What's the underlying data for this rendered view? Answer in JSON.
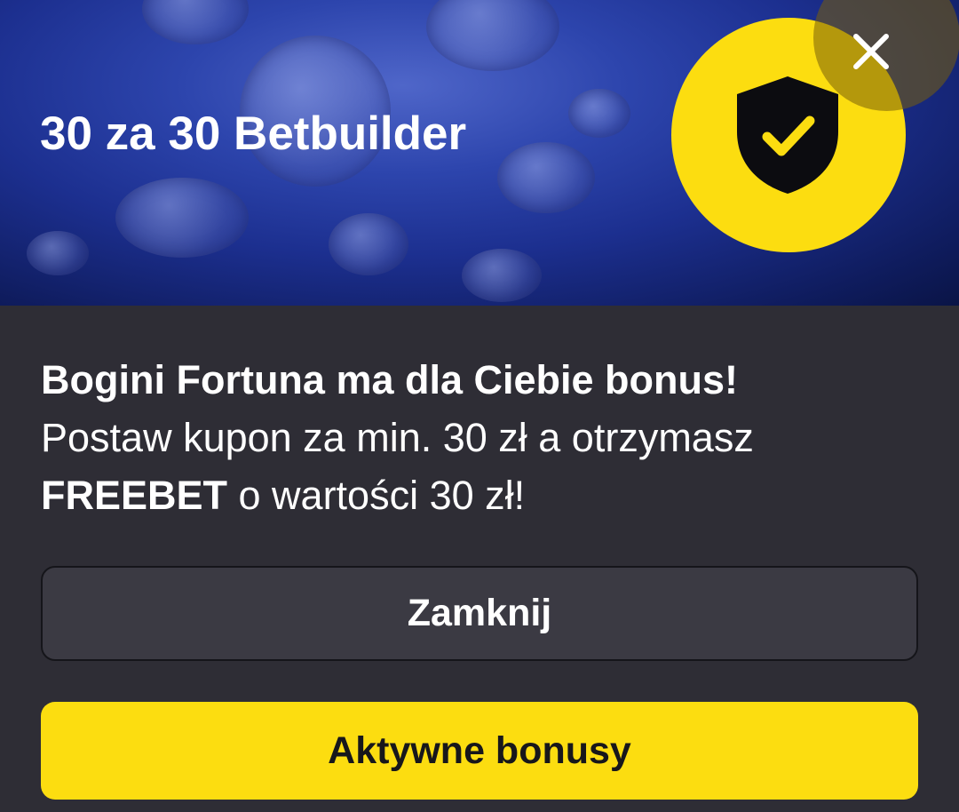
{
  "banner": {
    "title": "30 za 30 Betbuilder",
    "badge_icon": "shield-check-icon",
    "accent_color": "#fcdd10"
  },
  "header": {
    "close_icon": "close-icon"
  },
  "message": {
    "headline": "Bogini Fortuna ma dla Ciebie bonus!",
    "line_part1": "Postaw kupon za min. 30 zł a otrzymasz",
    "emphasis": "FREEBET",
    "line_part2": " o wartości 30 zł!"
  },
  "buttons": {
    "close_label": "Zamknij",
    "active_bonuses_label": "Aktywne bonusy"
  }
}
